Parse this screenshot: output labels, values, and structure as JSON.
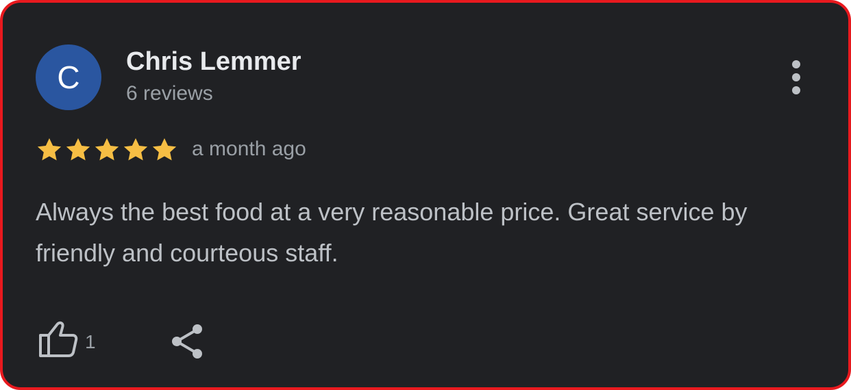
{
  "review": {
    "avatar_letter": "C",
    "author": "Chris Lemmer",
    "review_count": "6 reviews",
    "rating": 5,
    "rating_max": 5,
    "time": "a month ago",
    "text": "Always the best food at a very reasonable price. Great service by friendly and courteous staff.",
    "likes": "1"
  },
  "colors": {
    "background": "#202124",
    "border": "#e8191e",
    "avatar": "#2a56a0",
    "star": "#f6be44",
    "primary_text": "#e8eaed",
    "secondary_text": "#9aa0a6"
  },
  "icons": {
    "menu": "more-vertical-icon",
    "star": "star-icon",
    "like": "thumbs-up-icon",
    "share": "share-icon"
  }
}
